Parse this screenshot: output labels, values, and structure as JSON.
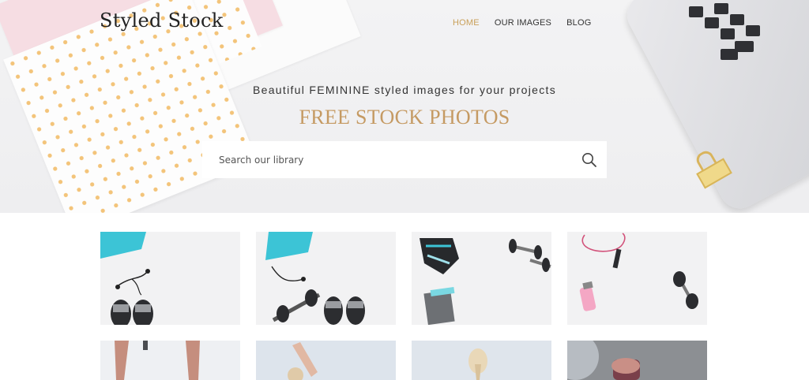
{
  "brand": {
    "name": "Styled Stock"
  },
  "nav": {
    "items": [
      {
        "label": "HOME",
        "active": true
      },
      {
        "label": "OUR IMAGES",
        "active": false
      },
      {
        "label": "BLOG",
        "active": false
      }
    ]
  },
  "hero": {
    "tagline": "Beautiful FEMININE styled images for your projects",
    "headline": "FREE STOCK PHOTOS",
    "search": {
      "placeholder": "Search our library",
      "value": ""
    }
  },
  "colors": {
    "accent_gold": "#c9a05a",
    "headline": "#c59a63",
    "turquoise": "#3cc4d6",
    "pink": "#f6dde3"
  },
  "gallery": {
    "row1": [
      {
        "subject": "turquoise towel, earphones and sneakers"
      },
      {
        "subject": "turquoise towel, earphones, dumbbell and sneakers"
      },
      {
        "subject": "sports bra, dumbbells and leggings"
      },
      {
        "subject": "jump rope, dumbbell and pink water bottle"
      }
    ],
    "row2": [
      {
        "subject": "legs"
      },
      {
        "subject": "woman stretching arm"
      },
      {
        "subject": "woman with ponytail"
      },
      {
        "subject": "hand holding bottle"
      }
    ]
  },
  "icons": {
    "search": "search-icon"
  }
}
